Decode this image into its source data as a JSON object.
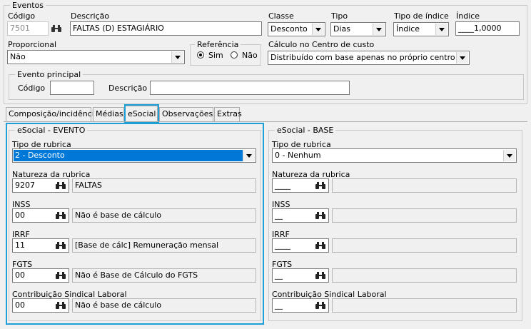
{
  "eventos": {
    "title": "Eventos",
    "codigo_label": "Código",
    "codigo_value": "7501",
    "descricao_label": "Descrição",
    "descricao_value": "FALTAS (D) ESTAGIÁRIO",
    "classe_label": "Classe",
    "classe_value": "Desconto",
    "tipo_label": "Tipo",
    "tipo_value": "Dias",
    "tipo_indice_label": "Tipo de índice",
    "tipo_indice_value": "Índice",
    "indice_label": "Índice",
    "indice_value": "____1,0000",
    "proporcional_label": "Proporcional",
    "proporcional_value": "Não",
    "referencia_label": "Referência",
    "referencia_sim": "Sim",
    "referencia_nao": "Não",
    "referencia_selected": "Sim",
    "calculo_label": "Cálculo no Centro de custo",
    "calculo_value": "Distribuído com base apenas no próprio centro custo",
    "evento_principal": {
      "title": "Evento principal",
      "codigo_label": "Código",
      "codigo_value": "",
      "descricao_label": "Descrição",
      "descricao_value": ""
    }
  },
  "tabs": [
    {
      "label": "Composição/incidência"
    },
    {
      "label": "Médias"
    },
    {
      "label": "eSocial"
    },
    {
      "label": "Observações"
    },
    {
      "label": "Extras"
    }
  ],
  "active_tab": "eSocial",
  "esocial_evento": {
    "title": "eSocial - EVENTO",
    "tipo_rubrica_label": "Tipo de rubrica",
    "tipo_rubrica_value": "2 - Desconto",
    "natureza_label": "Natureza da rubrica",
    "natureza_code": "9207",
    "natureza_desc": "FALTAS",
    "inss_label": "INSS",
    "inss_code": "00",
    "inss_desc": "Não é base de cálculo",
    "irrf_label": "IRRF",
    "irrf_code": "11",
    "irrf_desc": "[Base de cálc] Remuneração mensal",
    "fgts_label": "FGTS",
    "fgts_code": "00",
    "fgts_desc": "Não é Base de Cálculo do FGTS",
    "sindical_label": "Contribuição Sindical Laboral",
    "sindical_code": "00",
    "sindical_desc": "Não é base de cálculo"
  },
  "esocial_base": {
    "title": "eSocial - BASE",
    "tipo_rubrica_label": "Tipo de rubrica",
    "tipo_rubrica_value": "0 - Nenhum",
    "natureza_label": "Natureza da rubrica",
    "natureza_code": "____",
    "inss_label": "INSS",
    "inss_code": "__",
    "irrf_label": "IRRF",
    "irrf_code": "____",
    "fgts_label": "FGTS",
    "fgts_code": "__",
    "sindical_label": "Contribuição Sindical Laboral",
    "sindical_code": "__"
  },
  "colors": {
    "highlight": "#1ea0d7",
    "selection": "#0078d7",
    "background": "#f0f0f0"
  },
  "icons": {
    "lookup": "binoculars-icon"
  }
}
